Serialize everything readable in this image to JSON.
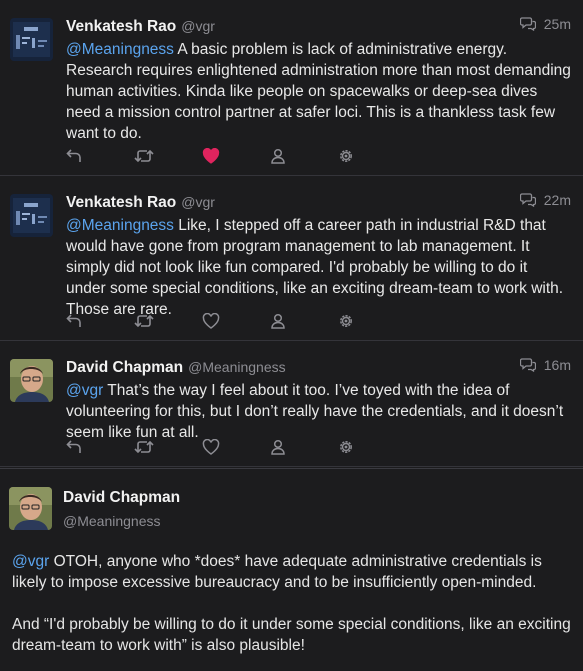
{
  "tweets": [
    {
      "name": "Venkatesh Rao",
      "handle": "@vgr",
      "time": "25m",
      "mention": "@Meaningness",
      "body": " A basic problem is lack of administrative energy. Research requires enlightened administration more than most demanding human activities. Kinda like people on spacewalks or deep-sea dives need a mission control partner at safer loci. This is a thankless task few want to do.",
      "liked": true
    },
    {
      "name": "Venkatesh Rao",
      "handle": "@vgr",
      "time": "22m",
      "mention": "@Meaningness",
      "body": " Like, I stepped off a career path in industrial R&D that would have gone from program management to lab management. It simply did not look like fun compared. I'd probably be willing to do it under some special conditions, like an exciting dream-team to work with. Those are rare.",
      "liked": false
    },
    {
      "name": "David Chapman",
      "handle": "@Meaningness",
      "time": "16m",
      "mention": "@vgr",
      "body": " That’s the way I feel about it too. I’ve toyed with the idea of volunteering for this, but I don’t really have the credentials, and it doesn’t seem like fun at all.",
      "liked": false
    }
  ],
  "expanded": {
    "name": "David Chapman",
    "handle": "@Meaningness",
    "mention": "@vgr",
    "body1": " OTOH, anyone who *does* have adequate administrative credentials is likely to impose excessive bureaucracy and to be insufficiently open-minded.",
    "body2": "And “I'd probably be willing to do it under some special conditions, like an exciting dream-team to work with” is also plausible!"
  },
  "icons": [
    "reply-icon",
    "retweet-icon",
    "like-icon",
    "follow-icon",
    "settings-icon",
    "conversation-icon"
  ],
  "colors": {
    "like_active": "#e0245e",
    "mention": "#5ba4ee",
    "background": "#1c1c1e"
  }
}
